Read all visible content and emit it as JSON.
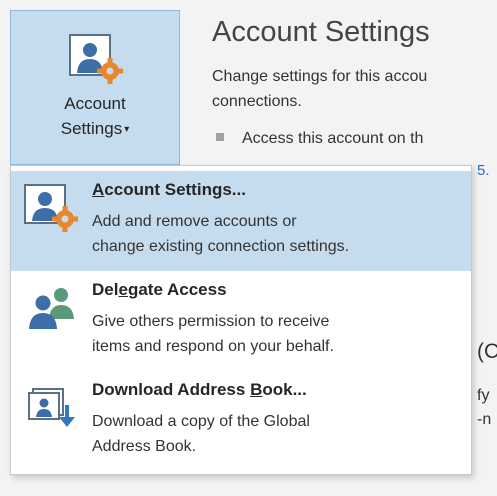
{
  "ribbon": {
    "button_label_line1": "Account",
    "button_label_line2": "Settings",
    "button_caret": "▾"
  },
  "header": {
    "title": "Account Settings",
    "description_line1": "Change settings for this accou",
    "description_line2": "connections.",
    "bullet_text": "Access this account on th",
    "link_fragment": "5."
  },
  "background_fragments": {
    "paren": "(C",
    "line1": "fy",
    "line2": "-n"
  },
  "menu": {
    "items": [
      {
        "title_pre": "",
        "title_u": "A",
        "title_post": "ccount Settings...",
        "desc_line1": "Add and remove accounts or",
        "desc_line2": "change existing connection settings.",
        "icon": "account-settings-icon"
      },
      {
        "title_pre": "Del",
        "title_u": "e",
        "title_post": "gate Access",
        "desc_line1": "Give others permission to receive",
        "desc_line2": "items and respond on your behalf.",
        "icon": "delegate-access-icon"
      },
      {
        "title_pre": "Download Address ",
        "title_u": "B",
        "title_post": "ook...",
        "desc_line1": "Download a copy of the Global",
        "desc_line2": "Address Book.",
        "icon": "download-address-book-icon"
      }
    ]
  },
  "colors": {
    "highlight": "#c5dcef",
    "accent_orange": "#e8882a",
    "person_blue": "#3d6ea8",
    "person_green": "#5a9a7a"
  }
}
